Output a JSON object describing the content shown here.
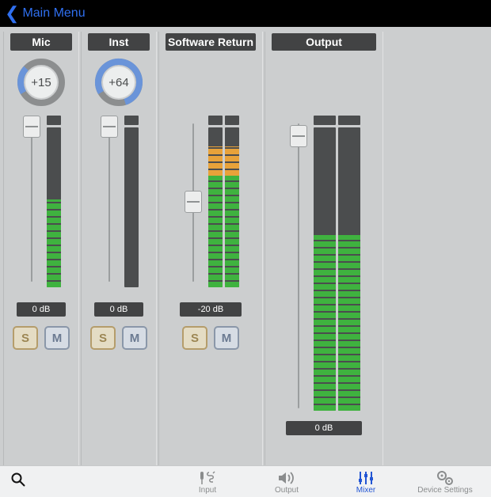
{
  "header": {
    "back_label": "Main Menu"
  },
  "channels": {
    "mic": {
      "label": "Mic",
      "gain": "+15",
      "gain_pct": 0.2,
      "fader_pct": 1.0,
      "meter_green_pct": 0.55,
      "meter_orange_pct": 0.0,
      "db": "0 dB",
      "solo": "S",
      "mute": "M"
    },
    "inst": {
      "label": "Inst",
      "gain": "+64",
      "gain_pct": 0.86,
      "fader_pct": 1.0,
      "meter_green_pct": 0.0,
      "meter_orange_pct": 0.0,
      "db": "0 dB",
      "solo": "S",
      "mute": "M"
    },
    "swret": {
      "label": "Software Return",
      "fader_pct": 0.55,
      "meter_green_pct": 0.7,
      "meter_orange_pct": 0.18,
      "db": "-20 dB",
      "solo": "S",
      "mute": "M"
    },
    "output": {
      "label": "Output",
      "fader_pct": 0.96,
      "meter_green_pct": 0.62,
      "meter_orange_pct": 0.0,
      "db": "0 dB"
    }
  },
  "tabs": {
    "input": "Input",
    "output": "Output",
    "mixer": "Mixer",
    "device_settings": "Device Settings"
  },
  "colors": {
    "accent": "#2f6fef",
    "dial_arc": "#6a94d9",
    "meter_green": "#3fb23f",
    "meter_orange": "#e8a23a"
  }
}
